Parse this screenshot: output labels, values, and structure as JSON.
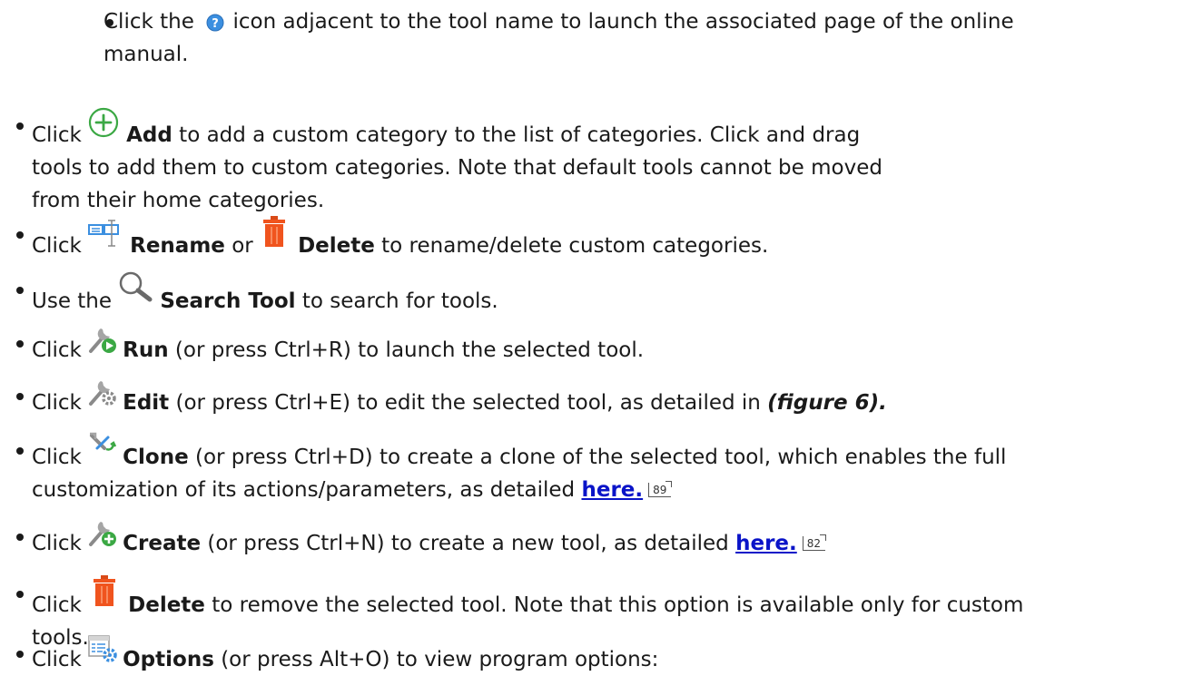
{
  "items": {
    "help": {
      "pre": "Click the",
      "post": " icon adjacent to the tool name to launch the associated page of the online",
      "cont": "manual."
    },
    "add": {
      "pre": "Click ",
      "bold": "Add",
      "post": " to add a custom category to the list of categories. Click and drag",
      "cont1": "tools to add them to custom categories. Note that default tools cannot be moved",
      "cont2": "from their home categories."
    },
    "rename": {
      "pre": "Click ",
      "bold1": "Rename",
      "mid": " or ",
      "bold2": "Delete",
      "post": " to rename/delete custom categories."
    },
    "search": {
      "pre": "Use the ",
      "bold": "Search Tool",
      "post": " to search for tools."
    },
    "run": {
      "pre": "Click ",
      "bold": "Run",
      "post": " (or press Ctrl+R) to launch the selected tool."
    },
    "edit": {
      "pre": "Click ",
      "bold": "Edit",
      "post": " (or press Ctrl+E) to edit the selected tool, as detailed in ",
      "ref": "(figure 6)."
    },
    "clone": {
      "pre": "Click ",
      "bold": "Clone",
      "post": " (or press Ctrl+D) to create a clone of the selected tool, which enables the full",
      "cont": "customization of its actions/parameters, as detailed ",
      "link": "here.",
      "page": "89"
    },
    "create": {
      "pre": "Click ",
      "bold": "Create",
      "post": " (or press Ctrl+N) to create a new tool, as detailed ",
      "link": "here.",
      "page": "82"
    },
    "delete": {
      "pre": "Click ",
      "bold": "Delete",
      "post": " to remove the selected tool. Note that this option is available only for custom",
      "cont": "tools."
    },
    "options": {
      "pre": "Click ",
      "bold": "Options",
      "post": " (or press Alt+O) to view program options:"
    }
  },
  "icons": {
    "help": "help-icon",
    "add": "add-icon",
    "rename": "rename-icon",
    "delete": "trash-icon",
    "search": "search-icon",
    "run": "run-icon",
    "edit": "edit-icon",
    "clone": "clone-icon",
    "create": "create-icon",
    "options": "options-icon"
  },
  "colors": {
    "link": "#0a14c8",
    "trash": "#f0541e",
    "green": "#3ba844",
    "help": "#3b8fe0"
  }
}
